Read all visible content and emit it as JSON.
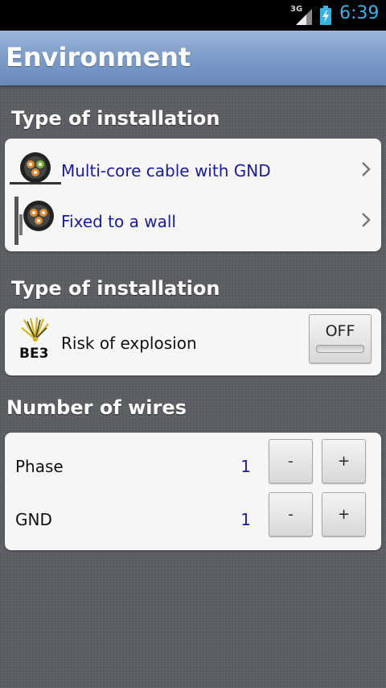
{
  "status_bar": {
    "network": "3G",
    "time": "6:39"
  },
  "header": {
    "title": "Environment"
  },
  "installation_section": {
    "title": "Type of installation",
    "items": [
      {
        "label": "Multi-core cable with GND"
      },
      {
        "label": "Fixed to a wall"
      }
    ]
  },
  "explosion_section": {
    "title": "Type of installation",
    "icon_label": "BE3",
    "label": "Risk of explosion",
    "toggle": "OFF"
  },
  "wires_section": {
    "title": "Number of wires",
    "rows": [
      {
        "label": "Phase",
        "value": "1",
        "minus": "-",
        "plus": "+"
      },
      {
        "label": "GND",
        "value": "1",
        "minus": "-",
        "plus": "+"
      }
    ]
  },
  "colors": {
    "link": "#1a1aa8",
    "accent": "#33b5e5",
    "header": "#7e9ecb"
  }
}
